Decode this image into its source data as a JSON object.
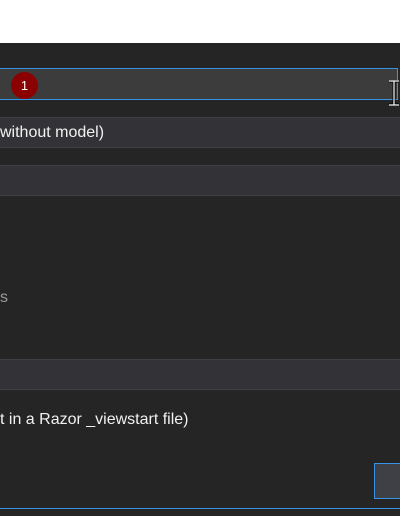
{
  "dialog": {
    "name_field": {
      "value": "",
      "error_badge": "1"
    },
    "template_select": {
      "selected": "without model)"
    },
    "model_select": {
      "selected": ""
    },
    "options_partial_label": "s",
    "layout_select": {
      "selected": ""
    },
    "layout_hint": "t in a Razor _viewstart file)"
  },
  "colors": {
    "dialog_bg": "#252526",
    "input_bg": "#3c3c3c",
    "focus_border": "#3794e4",
    "error_badge": "#8b0000"
  }
}
